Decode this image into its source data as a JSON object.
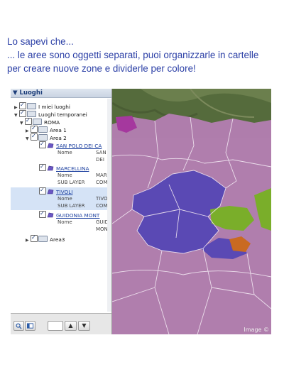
{
  "caption": {
    "line1": "Lo sapevi che...",
    "line2": "... le aree sono oggetti separati, puoi organizzarle in cartelle",
    "line3": "per creare nuove zone e dividerle per colore!"
  },
  "panel": {
    "header": "▼ Luoghi",
    "tree": {
      "my_places": "I miei luoghi",
      "temp_places": "Luoghi temporanei",
      "roma": "ROMA",
      "area1": "Area 1",
      "area2": "Area 2",
      "area3": "Area3",
      "items": [
        {
          "label": "SAN POLO DEI CA",
          "k1": "Nome",
          "v1": "SAN",
          "k2": "",
          "v2": "DEI"
        },
        {
          "label": "MARCELLINA",
          "k1": "Nome",
          "v1": "MAR",
          "k2": "SUB LAYER",
          "v2": "COM"
        },
        {
          "label": "TIVOLI",
          "k1": "Nome",
          "v1": "TIVO",
          "k2": "SUB LAYER",
          "v2": "COM"
        },
        {
          "label": "GUIDONIA MONT",
          "k1": "Nome",
          "v1": "GUID",
          "k2": "",
          "v2": "MON"
        }
      ]
    },
    "bottom": {
      "search_icon": "search-icon",
      "panel_icon": "panel-toggle-icon",
      "up_label": "▲",
      "down_label": "▼"
    }
  },
  "map": {
    "attribution": "Image ©",
    "colors": {
      "pink": "#b77fb6",
      "blue": "#5a49b4",
      "green": "#7aae2a",
      "orange": "#c96a22",
      "magenta": "#a5389e"
    }
  }
}
